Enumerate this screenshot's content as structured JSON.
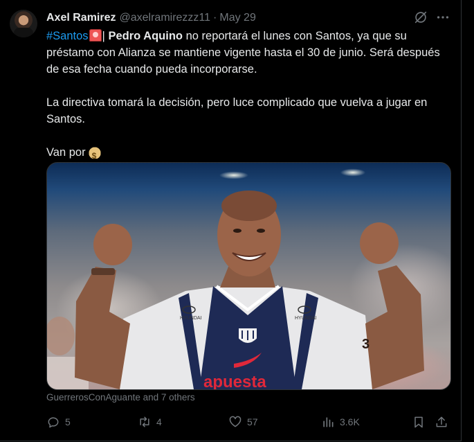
{
  "tweet": {
    "author_name": "Axel Ramirez",
    "author_handle": "@axelramirezzz11",
    "separator": "·",
    "date": "May 29",
    "hashtag": "#Santos",
    "pipe": "|",
    "player_name": "Pedro Aquino",
    "text_line1": " no reportará el lunes con Santos, ya que su préstamo con Alianza se mantiene vigente hasta el 30 de junio. Será después de esa fecha cuando pueda incorporarse.",
    "paragraph2": "La directiva tomará la decisión, pero luce complicado que vuelva a jugar en Santos.",
    "paragraph3": "Van por",
    "emoji_light": "rotating-light",
    "emoji_money": "money-bag",
    "media_caption": "GuerrerosConAguante and 7 others",
    "jersey_sponsor": "apuesta",
    "jersey_brand": "HYUNDAI",
    "jersey_number": "3"
  },
  "actions": {
    "replies": "5",
    "retweets": "4",
    "likes": "57",
    "views": "3.6K"
  },
  "icons": {
    "grok": "grok-icon",
    "more": "more-icon",
    "reply": "reply-icon",
    "retweet": "retweet-icon",
    "like": "heart-icon",
    "views": "views-icon",
    "bookmark": "bookmark-icon",
    "share": "share-icon"
  },
  "colors": {
    "background": "#000000",
    "text": "#e7e9ea",
    "muted": "#71767b",
    "link": "#1d9bf0",
    "border": "#2f3336"
  }
}
